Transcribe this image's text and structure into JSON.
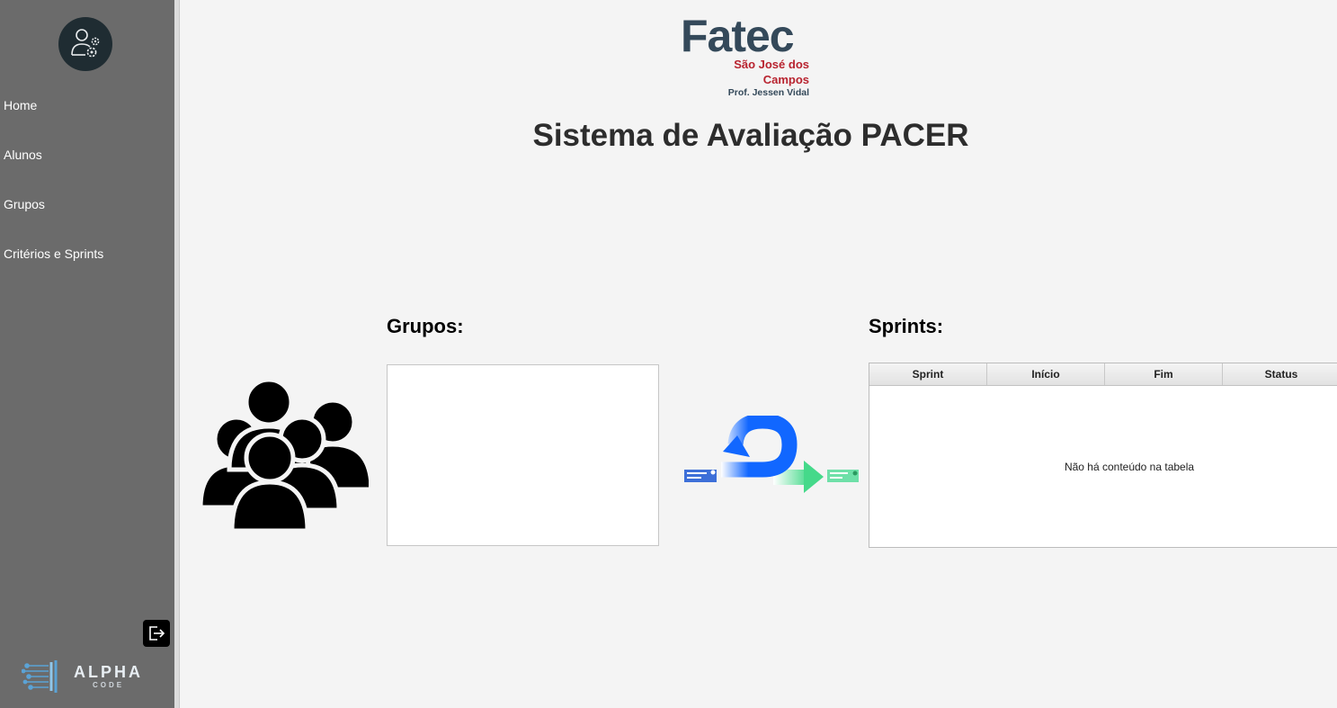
{
  "sidebar": {
    "items": [
      {
        "label": "Home"
      },
      {
        "label": "Alunos"
      },
      {
        "label": "Grupos"
      },
      {
        "label": "Critérios e Sprints"
      }
    ],
    "logo": {
      "word": "ALPHA",
      "sub": "CODE"
    }
  },
  "header": {
    "logo": {
      "word": "Fatec",
      "line1": "São José dos",
      "line2": "Campos",
      "line3": "Prof. Jessen Vidal"
    },
    "title": "Sistema de Avaliação PACER"
  },
  "groups": {
    "title": "Grupos:"
  },
  "sprints": {
    "title": "Sprints:",
    "columns": [
      "Sprint",
      "Início",
      "Fim",
      "Status"
    ],
    "empty_message": "Não há conteúdo na tabela"
  },
  "icons": {
    "avatar": "user-settings-icon",
    "groups": "people-group-icon",
    "sprint": "sprint-cycle-icon",
    "logout": "logout-icon"
  }
}
